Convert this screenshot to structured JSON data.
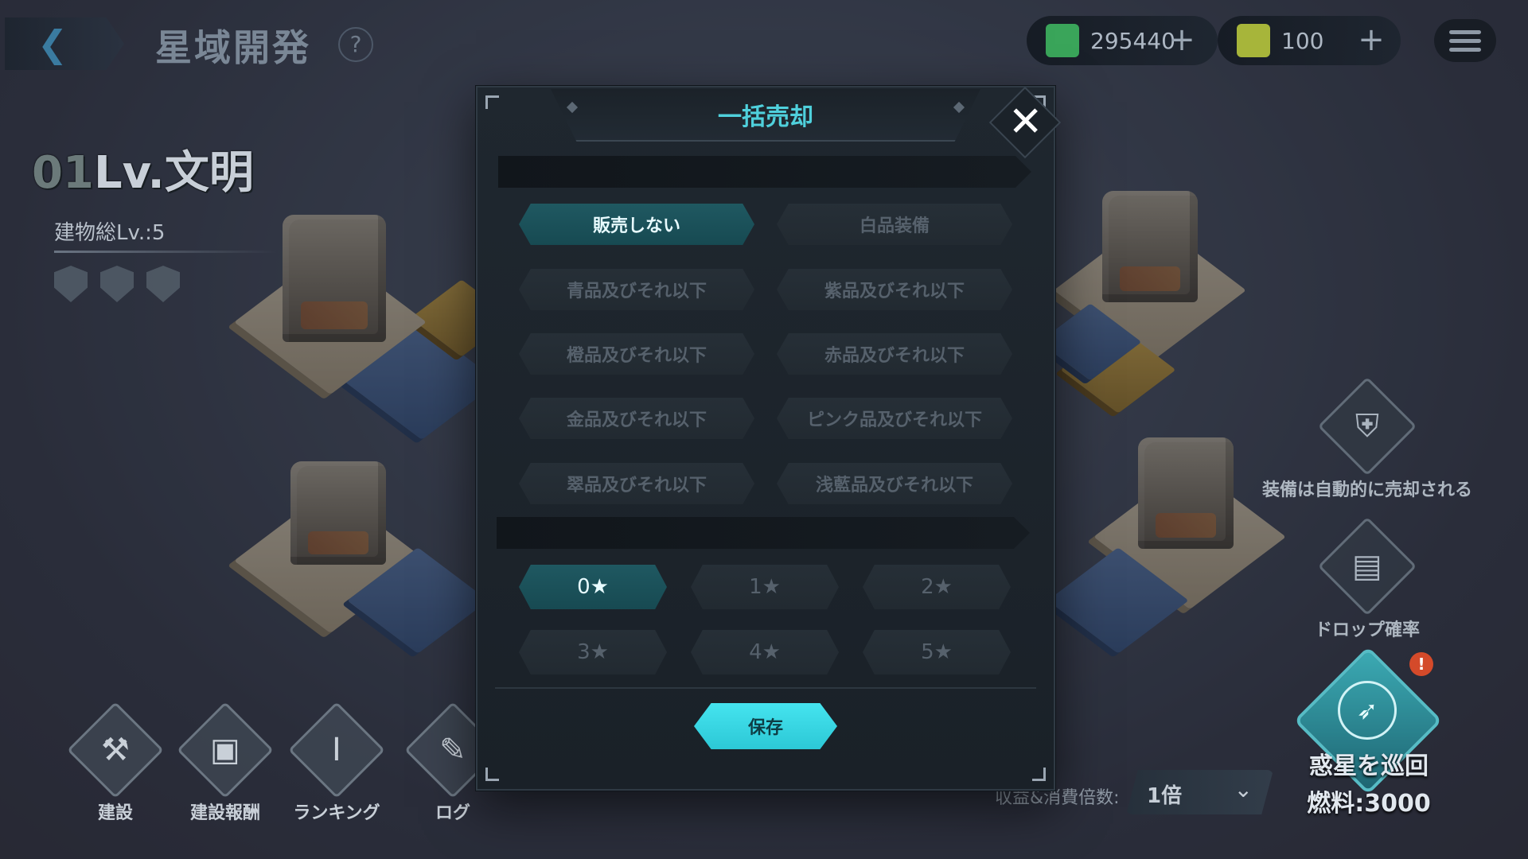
{
  "header": {
    "back_icon": "back-arrow-icon",
    "title": "星域開発",
    "help_label": "?",
    "resources": [
      {
        "icon": "credits-icon",
        "value": "295440",
        "color": "#3aa55a"
      },
      {
        "icon": "ticket-icon",
        "value": "100",
        "color": "#a7b53a"
      }
    ],
    "plus_label": "+",
    "menu_icon": "hamburger-menu-icon"
  },
  "civilization": {
    "level_prefix": "01",
    "level_text": "Lv.文明",
    "building_total": "建物総Lv.:5"
  },
  "bottom_nav": [
    {
      "label": "建設",
      "icon": "construction-icon",
      "glyph": "⚒"
    },
    {
      "label": "建設報酬",
      "icon": "reward-chest-icon",
      "glyph": "▣"
    },
    {
      "label": "ランキング",
      "icon": "ranking-icon",
      "glyph": "Ⅰ"
    },
    {
      "label": "ログ",
      "icon": "log-icon",
      "glyph": "✎"
    }
  ],
  "side_buttons": {
    "auto_sell": {
      "label": "装備は自動的に売却される",
      "icon": "auto-sell-shield-icon",
      "glyph": "⛨"
    },
    "drop_rate": {
      "label": "ドロップ確率",
      "icon": "drop-rate-icon",
      "glyph": "▤"
    }
  },
  "multiplier": {
    "label": "収益&消費倍数:",
    "value": "1倍",
    "chevron": "⌄"
  },
  "patrol": {
    "label": "惑星を巡回",
    "fuel": "燃料:3000",
    "badge": "!",
    "glyph": "➶"
  },
  "modal": {
    "title": "一括売却",
    "close_label": "✕",
    "quality_options": [
      {
        "label": "販売しない",
        "selected": true
      },
      {
        "label": "白品装備",
        "selected": false
      },
      {
        "label": "青品及びそれ以下",
        "selected": false
      },
      {
        "label": "紫品及びそれ以下",
        "selected": false
      },
      {
        "label": "橙品及びそれ以下",
        "selected": false
      },
      {
        "label": "赤品及びそれ以下",
        "selected": false
      },
      {
        "label": "金品及びそれ以下",
        "selected": false
      },
      {
        "label": "ピンク品及びそれ以下",
        "selected": false
      },
      {
        "label": "翠品及びそれ以下",
        "selected": false
      },
      {
        "label": "浅藍品及びそれ以下",
        "selected": false
      }
    ],
    "star_options": [
      {
        "label": "0★",
        "selected": true
      },
      {
        "label": "1★",
        "selected": false
      },
      {
        "label": "2★",
        "selected": false
      },
      {
        "label": "3★",
        "selected": false
      },
      {
        "label": "4★",
        "selected": false
      },
      {
        "label": "5★",
        "selected": false
      }
    ],
    "save_label": "保存"
  },
  "colors": {
    "accent": "#4fd0dc",
    "selected_option": "#1f5861",
    "save_button": "#45e4ef"
  }
}
